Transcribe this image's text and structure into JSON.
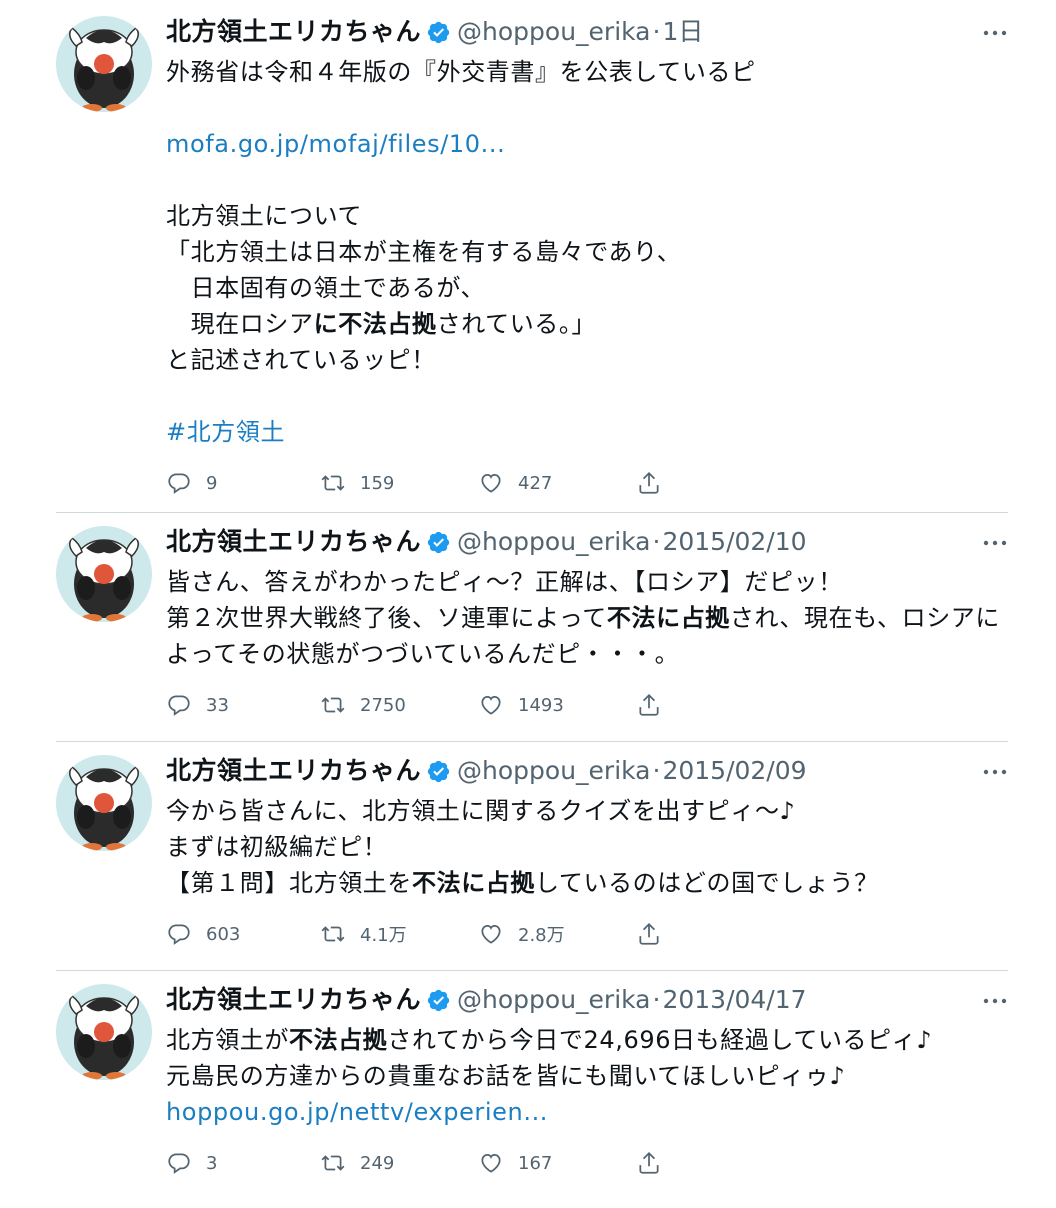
{
  "colors": {
    "link": "#1b7ec2",
    "verified": "#1d9bf0",
    "secondary_text": "#536471",
    "divider": "#cfd9de"
  },
  "tweets": [
    {
      "name": "北方領土エリカちゃん",
      "handle": "@hoppou_erika",
      "time": "1日",
      "lines": [
        [
          {
            "t": "外務省は令和４年版の『外交青書』を公表しているピ"
          }
        ],
        [],
        [
          {
            "t": "mofa.go.jp/mofaj/files/10...",
            "link": true
          }
        ],
        [],
        [
          {
            "t": "北方領土について"
          }
        ],
        [
          {
            "t": "「北方領土は日本が主権を有する島々であり、"
          }
        ],
        [
          {
            "t": "　日本固有の領土であるが、"
          }
        ],
        [
          {
            "t": "　現在ロシア"
          },
          {
            "t": "に不法占拠",
            "b": true
          },
          {
            "t": "されている。」"
          }
        ],
        [
          {
            "t": "と記述されているッピ！"
          }
        ],
        [],
        [
          {
            "t": "#北方領土",
            "link": true
          }
        ]
      ],
      "replies": "9",
      "retweets": "159",
      "likes": "427"
    },
    {
      "name": "北方領土エリカちゃん",
      "handle": "@hoppou_erika",
      "time": "2015/02/10",
      "lines": [
        [
          {
            "t": "皆さん、答えがわかったピィ～？正解は、【ロシア】だピッ！"
          }
        ],
        [
          {
            "t": "第２次世界大戦終了後、ソ連軍によって"
          },
          {
            "t": "不法に占拠",
            "b": true
          },
          {
            "t": "され、現在も、ロシアに"
          }
        ],
        [
          {
            "t": "よってその状態がつづいているんだピ・・・。"
          }
        ]
      ],
      "replies": "33",
      "retweets": "2750",
      "likes": "1493"
    },
    {
      "name": "北方領土エリカちゃん",
      "handle": "@hoppou_erika",
      "time": "2015/02/09",
      "lines": [
        [
          {
            "t": "今から皆さんに、北方領土に関するクイズを出すピィ～♪"
          }
        ],
        [
          {
            "t": "まずは初級編だピ！"
          }
        ],
        [
          {
            "t": "【第１問】北方領土を"
          },
          {
            "t": "不法に占拠",
            "b": true
          },
          {
            "t": "しているのはどの国でしょう？"
          }
        ]
      ],
      "replies": "603",
      "retweets": "4.1万",
      "likes": "2.8万"
    },
    {
      "name": "北方領土エリカちゃん",
      "handle": "@hoppou_erika",
      "time": "2013/04/17",
      "lines": [
        [
          {
            "t": "北方領土が"
          },
          {
            "t": "不法占拠",
            "b": true
          },
          {
            "t": "されてから今日で24,696日も経過しているピィ♪"
          }
        ],
        [
          {
            "t": "元島民の方達からの貴重なお話を皆にも聞いてほしいピィゥ♪"
          }
        ],
        [
          {
            "t": "hoppou.go.jp/nettv/experien...",
            "link": true
          }
        ]
      ],
      "replies": "3",
      "retweets": "249",
      "likes": "167"
    }
  ]
}
